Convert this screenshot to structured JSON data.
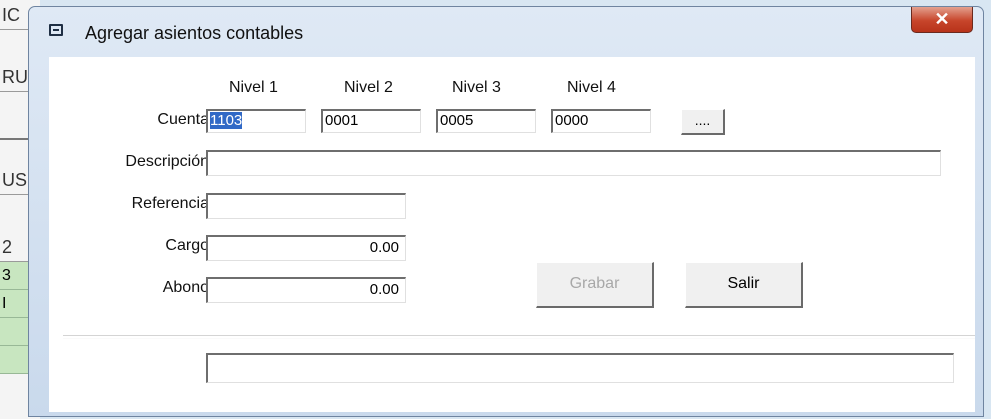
{
  "background": {
    "cells": [
      "IC",
      "RU",
      "",
      "US",
      "2"
    ],
    "green_cells": [
      "3",
      "I",
      "",
      ""
    ]
  },
  "dialog": {
    "title": "Agregar asientos contables",
    "close_label": "✕"
  },
  "form": {
    "nivel_headers": [
      "Nivel 1",
      "Nivel 2",
      "Nivel 3",
      "Nivel 4"
    ],
    "cuenta_label": "Cuenta",
    "cuenta_values": [
      "1103",
      "0001",
      "0005",
      "0000"
    ],
    "browse_label": "....",
    "descripcion_label": "Descripción",
    "descripcion_value": "",
    "referencia_label": "Referencia",
    "referencia_value": "",
    "cargo_label": "Cargo",
    "cargo_value": "0.00",
    "abono_label": "Abono",
    "abono_value": "0.00",
    "status_value": ""
  },
  "buttons": {
    "grabar": "Grabar",
    "salir": "Salir"
  },
  "colors": {
    "selection": "#3169c6",
    "close_button": "#c7452b"
  }
}
